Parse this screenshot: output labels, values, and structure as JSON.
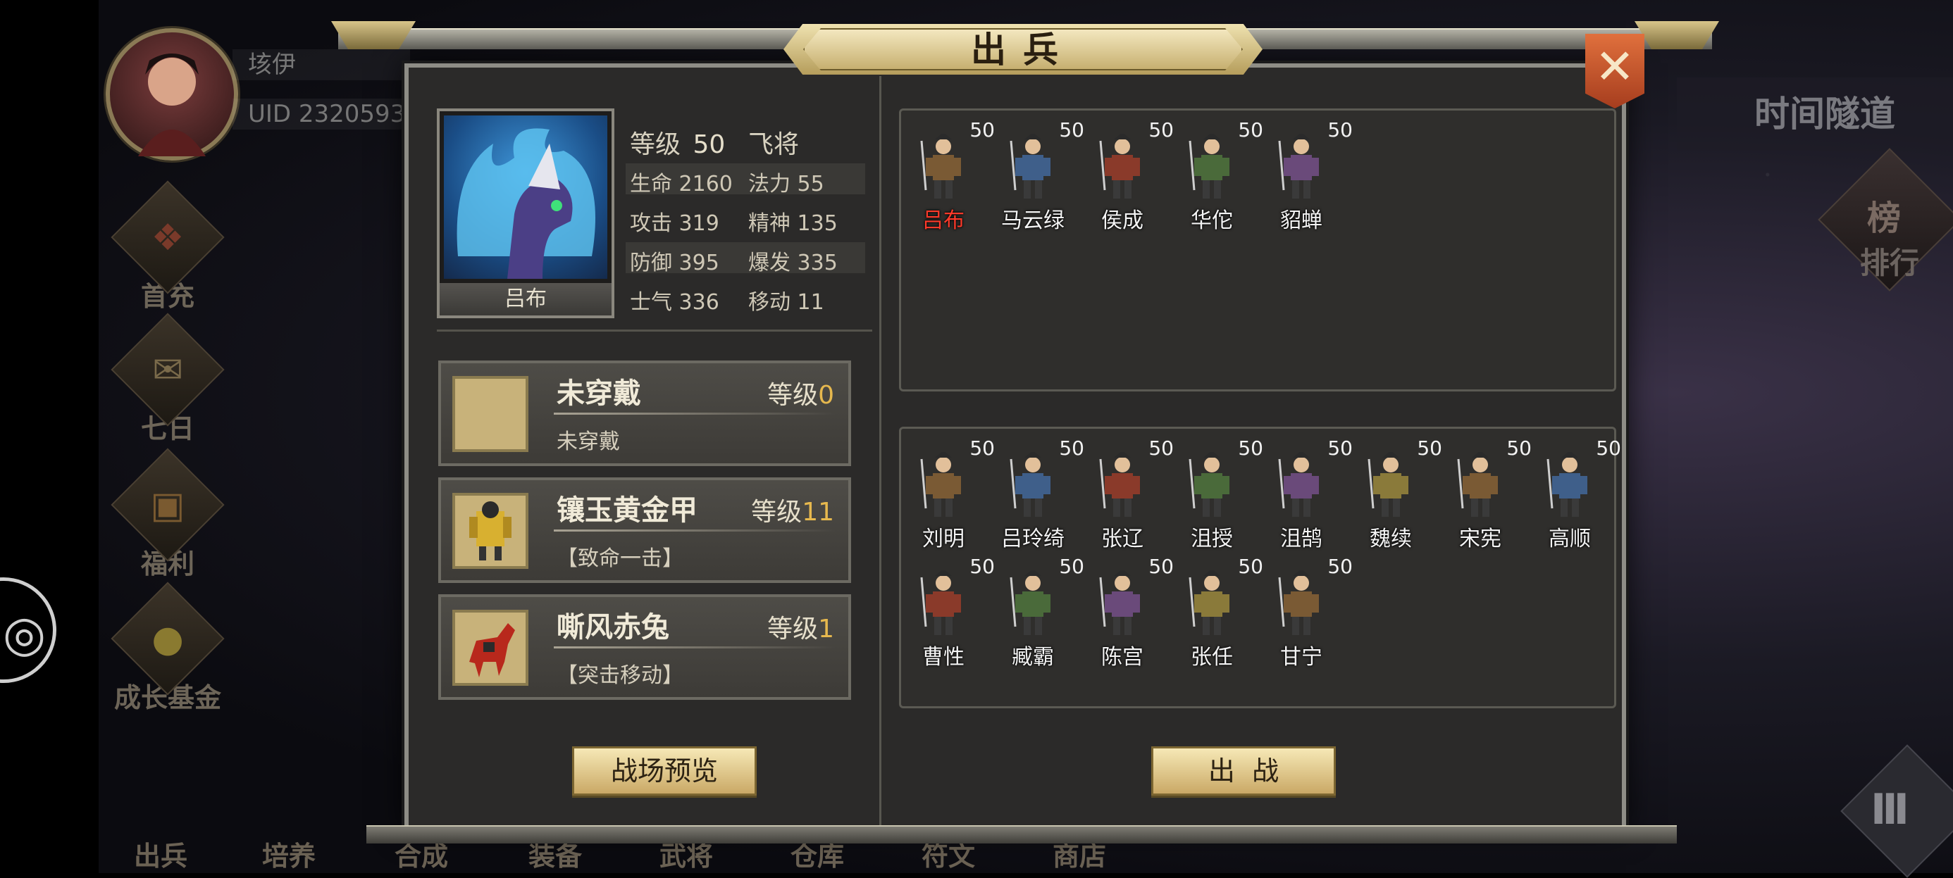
{
  "player": {
    "name": "垓伊",
    "uid": "UID  2320593"
  },
  "side_menu": [
    {
      "label": "首充",
      "icon": "gift-icon"
    },
    {
      "label": "七日",
      "icon": "scroll-icon"
    },
    {
      "label": "福利",
      "icon": "treasure-icon"
    },
    {
      "label": "成长基金",
      "icon": "gold-coins-icon"
    }
  ],
  "bottom_nav": [
    "出兵",
    "培养",
    "合成",
    "装备",
    "武将",
    "仓库",
    "符文",
    "商店"
  ],
  "right_panel": {
    "tunnel": "时间隧道",
    "rank": "排行",
    "rank_glyph": "榜"
  },
  "dialog": {
    "title": "出兵",
    "close_glyph": "✕",
    "hero": {
      "name": "吕布",
      "level_label": "等级",
      "level": "50",
      "class": "飞将",
      "stats": [
        {
          "label": "生命",
          "value": "2160"
        },
        {
          "label": "法力",
          "value": "55"
        },
        {
          "label": "攻击",
          "value": "319"
        },
        {
          "label": "精神",
          "value": "135"
        },
        {
          "label": "防御",
          "value": "395"
        },
        {
          "label": "爆发",
          "value": "335"
        },
        {
          "label": "士气",
          "value": "336"
        },
        {
          "label": "移动",
          "value": "11"
        }
      ]
    },
    "equipment": [
      {
        "name": "未穿戴",
        "sub": "未穿戴",
        "level_label": "等级",
        "level": "0",
        "icon": "empty-slot-icon"
      },
      {
        "name": "镶玉黄金甲",
        "sub": "【致命一击】",
        "level_label": "等级",
        "level": "11",
        "icon": "golden-armor-icon"
      },
      {
        "name": "嘶风赤兔",
        "sub": "【突击移动】",
        "level_label": "等级",
        "level": "1",
        "icon": "red-horse-icon"
      }
    ],
    "preview_button": "战场预览",
    "battle_button": "出  战",
    "deployed": [
      {
        "name": "吕布",
        "level": "50",
        "selected": true
      },
      {
        "name": "马云绿",
        "level": "50"
      },
      {
        "name": "侯成",
        "level": "50"
      },
      {
        "name": "华佗",
        "level": "50"
      },
      {
        "name": "貂蝉",
        "level": "50"
      }
    ],
    "reserve": [
      {
        "name": "刘明",
        "level": "50"
      },
      {
        "name": "吕玲绮",
        "level": "50"
      },
      {
        "name": "张辽",
        "level": "50"
      },
      {
        "name": "沮授",
        "level": "50"
      },
      {
        "name": "沮鹄",
        "level": "50"
      },
      {
        "name": "魏续",
        "level": "50"
      },
      {
        "name": "宋宪",
        "level": "50"
      },
      {
        "name": "高顺",
        "level": "50"
      },
      {
        "name": "曹性",
        "level": "50"
      },
      {
        "name": "臧霸",
        "level": "50"
      },
      {
        "name": "陈宫",
        "level": "50"
      },
      {
        "name": "张任",
        "level": "50"
      },
      {
        "name": "甘宁",
        "level": "50"
      }
    ]
  },
  "colors": {
    "gold": "#e6b84e",
    "selected_name": "#ff3a2a",
    "button": "#caa966",
    "close": "#d0562d"
  }
}
